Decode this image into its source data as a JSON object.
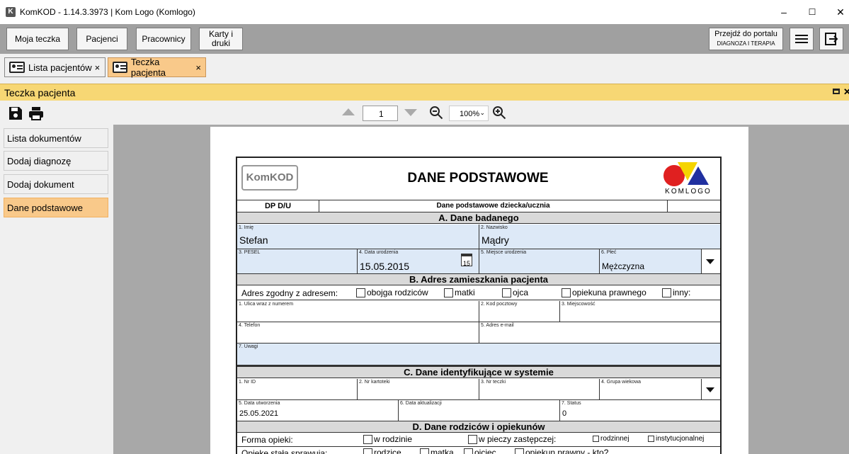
{
  "window": {
    "title": "KomKOD - 1.14.3.3973 | Kom Logo (Komlogo)",
    "app_icon": "K"
  },
  "toolbar": {
    "my_folder": "Moja teczka",
    "patients": "Pacjenci",
    "staff": "Pracownicy",
    "cards_line1": "Karty i",
    "cards_line2": "druki",
    "portal_line1": "Przejdź do portalu",
    "portal_line2": "DIAGNOZA I TERAPIA"
  },
  "tabs": [
    {
      "label": "Lista pacjentów",
      "close": "×"
    },
    {
      "label": "Teczka pacjenta",
      "close": "×"
    }
  ],
  "panel": {
    "title": "Teczka pacjenta"
  },
  "sidebar": {
    "items": [
      "Lista dokumentów",
      "Dodaj diagnozę",
      "Dodaj dokument",
      "Dane podstawowe"
    ]
  },
  "viewer": {
    "page": "1",
    "zoom": "100%"
  },
  "form": {
    "logo_left": "KomKOD",
    "title": "DANE PODSTAWOWE",
    "logo_right": "KOMLOGO",
    "code": "DP D/U",
    "subtitle": "Dane podstawowe dziecka/ucznia",
    "secA": "A. Dane badanego",
    "imie_lbl": "1. Imię",
    "imie": "Stefan",
    "nazwisko_lbl": "2. Nazwisko",
    "nazwisko": "Mądry",
    "pesel_lbl": "3. PESEL",
    "dob_lbl": "4. Data urodzenia",
    "dob": "15.05.2015",
    "cal_day": "15",
    "pob_lbl": "5. Miejsce urodzenia",
    "sex_lbl": "6. Płeć",
    "sex": "Mężczyzna",
    "secB": "B. Adres zamieszkania pacjenta",
    "addr_match": "Adres zgodny z adresem:",
    "addr_opts": [
      "obojga rodziców",
      "matki",
      "ojca",
      "opiekuna prawnego",
      "inny:"
    ],
    "street_lbl": "1. Ulica wraz z numerem",
    "zip_lbl": "2. Kod pocztowy",
    "city_lbl": "3. Miejscowość",
    "phone_lbl": "4. Telefon",
    "email_lbl": "5. Adres e-mail",
    "notes_lbl": "7. Uwagi",
    "secC": "C. Dane identyfikujące w systemie",
    "id_lbl": "1. Nr ID",
    "card_lbl": "2. Nr kartoteki",
    "folder_lbl": "3. Nr teczki",
    "age_lbl": "4. Grupa wiekowa",
    "created_lbl": "5. Data utworzenia",
    "created": "25.05.2021",
    "updated_lbl": "6. Data aktualizacji",
    "status_lbl": "7. Status",
    "status": "0",
    "secD": "D. Dane rodziców i opiekunów",
    "care_form": "Forma opieki:",
    "care_opts": [
      "w rodzinie",
      "w pieczy zastępczej:"
    ],
    "care_sub": [
      "rodzinnej",
      "instytucjonalnej"
    ],
    "care_by": "Opiekę stałą sprawują:",
    "care_by_opts": [
      "rodzice",
      "matka",
      "ojciec",
      "opiekun prawny - kto?"
    ]
  },
  "colors": {
    "toolbar": "#a0a0a0",
    "panel_header": "#f7d774",
    "active_item": "#f9c98a",
    "field_blue": "#dde9f7"
  }
}
